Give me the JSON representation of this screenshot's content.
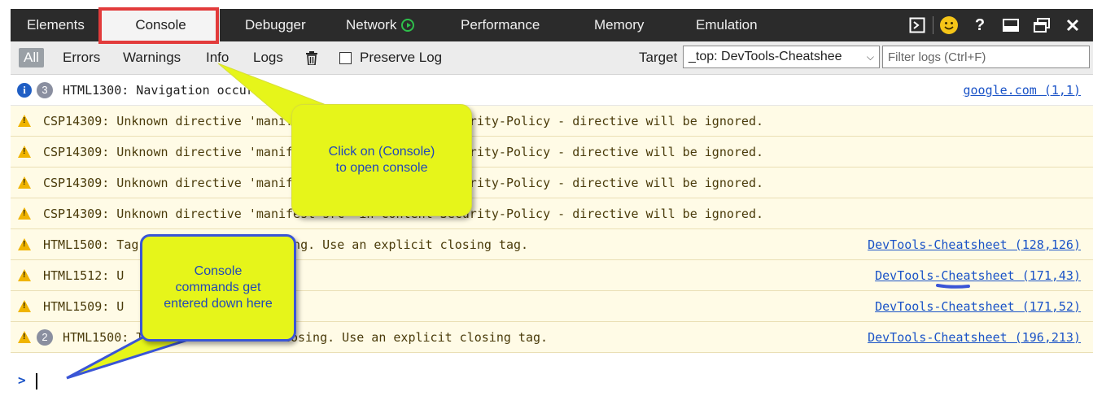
{
  "tabs": [
    {
      "label": "Elements"
    },
    {
      "label": "Console"
    },
    {
      "label": "Debugger"
    },
    {
      "label": "Network"
    },
    {
      "label": "Performance"
    },
    {
      "label": "Memory"
    },
    {
      "label": "Emulation"
    }
  ],
  "toolbar": {
    "all": "All",
    "errors": "Errors",
    "warnings": "Warnings",
    "info": "Info",
    "logs": "Logs",
    "preserve_log": "Preserve Log",
    "target_label": "Target",
    "target_value": "_top: DevTools-Cheatshee",
    "filter_placeholder": "Filter logs (Ctrl+F)"
  },
  "messages": [
    {
      "type": "info",
      "count": "3",
      "text": "HTML1300: Navigation occurred.",
      "source": "google.com (1,1)"
    },
    {
      "type": "warn",
      "text": "CSP14309: Unknown directive 'manifest-src' in Content-Security-Policy - directive will be ignored.",
      "source": ""
    },
    {
      "type": "warn",
      "text": "CSP14309: Unknown directive 'manifest-src' in Content-Security-Policy - directive will be ignored.",
      "source": ""
    },
    {
      "type": "warn",
      "text": "CSP14309: Unknown directive 'manifest-src' in Content-Security-Policy - directive will be ignored.",
      "source": ""
    },
    {
      "type": "warn",
      "text": "CSP14309: Unknown directive 'manifest-src' in Content-Security-Policy - directive will be ignored.",
      "source": ""
    },
    {
      "type": "warn",
      "text": "HTML1500: Tag cannot be self-closing. Use an explicit closing tag.",
      "source": "DevTools-Cheatsheet (128,126)"
    },
    {
      "type": "warn",
      "text": "HTML1512: U",
      "source": "DevTools-Cheatsheet (171,43)"
    },
    {
      "type": "warn",
      "text": "HTML1509: U",
      "source": "DevTools-Cheatsheet (171,52)"
    },
    {
      "type": "warn",
      "count": "2",
      "text": "HTML1500: Tag cannot be self-closing. Use an explicit closing tag.",
      "source": "DevTools-Cheatsheet (196,213)"
    }
  ],
  "prompt": ">",
  "callouts": {
    "console_tab": "Click on (Console) to open console",
    "console_input": "Console commands get entered down here"
  },
  "colors": {
    "tab_highlight": "#e23b3b",
    "callout_fill": "#e6f51a",
    "callout_text": "#2248b8",
    "warning_bg": "#fffbe6",
    "link": "#1a53c7"
  }
}
